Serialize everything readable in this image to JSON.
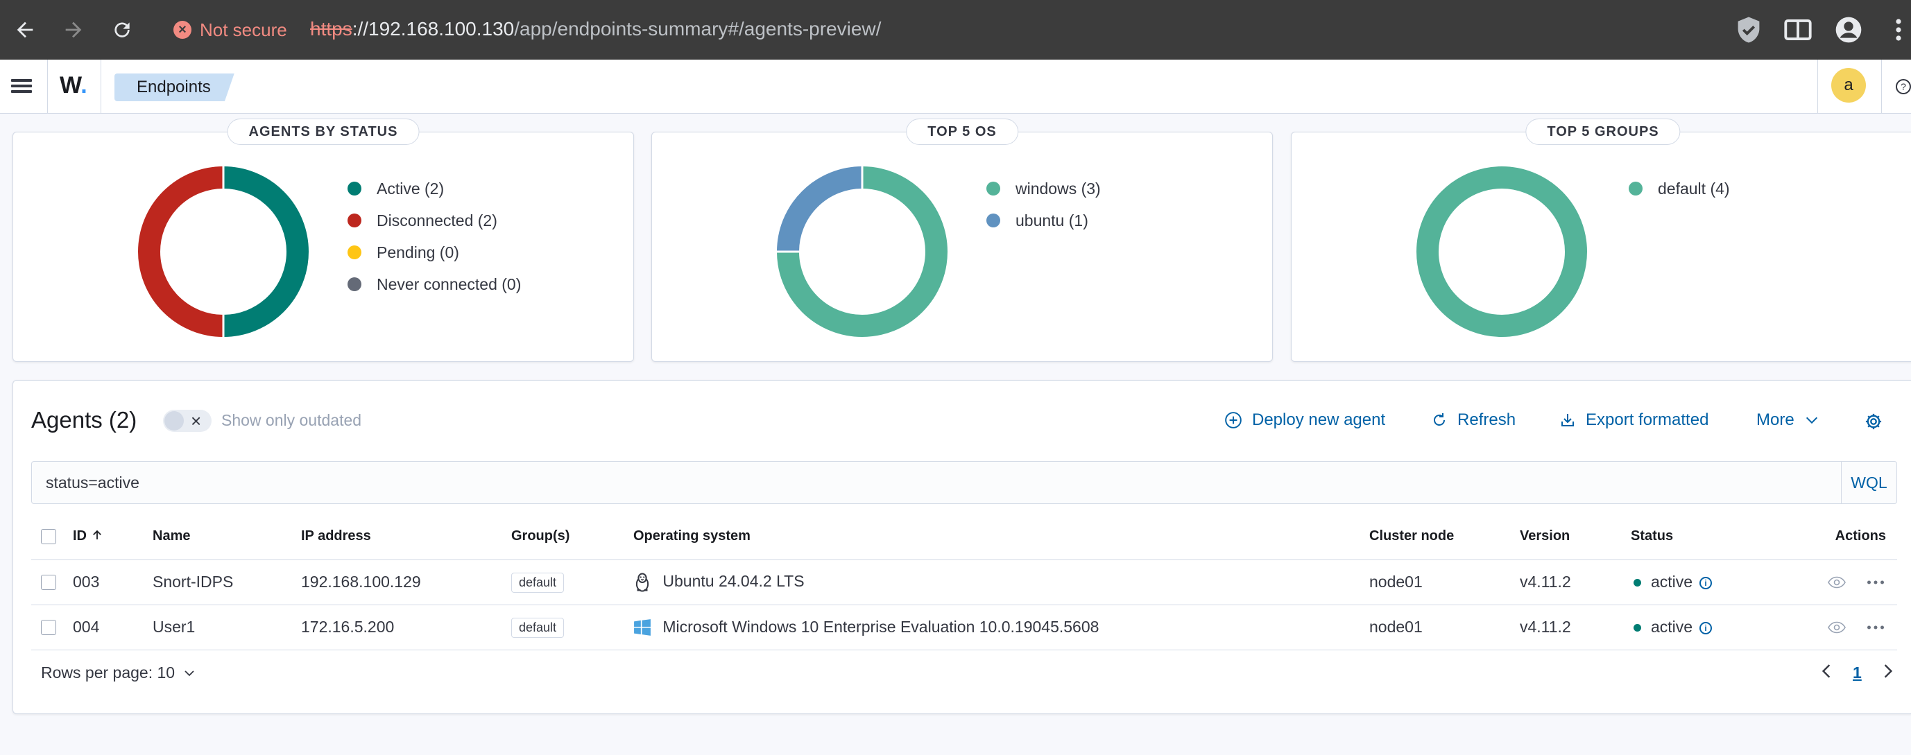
{
  "browser": {
    "security_label": "Not secure",
    "url_scheme": "https",
    "url_host": "://192.168.100.130",
    "url_path": "/app/endpoints-summary#/agents-preview/"
  },
  "header": {
    "logo_text": "W",
    "logo_dot": ".",
    "breadcrumb": "Endpoints",
    "avatar_initial": "a",
    "help_glyph": "?"
  },
  "cards": {
    "status": {
      "title": "AGENTS BY STATUS",
      "legend": [
        {
          "label": "Active (2)",
          "color": "#017d73",
          "value": 2
        },
        {
          "label": "Disconnected (2)",
          "color": "#bd271e",
          "value": 2
        },
        {
          "label": "Pending (0)",
          "color": "#fec514",
          "value": 0
        },
        {
          "label": "Never connected (0)",
          "color": "#646a77",
          "value": 0
        }
      ]
    },
    "os": {
      "title": "TOP 5 OS",
      "legend": [
        {
          "label": "windows (3)",
          "color": "#54b399",
          "value": 3
        },
        {
          "label": "ubuntu (1)",
          "color": "#6092c0",
          "value": 1
        }
      ]
    },
    "groups": {
      "title": "TOP 5 GROUPS",
      "legend": [
        {
          "label": "default (4)",
          "color": "#54b399",
          "value": 4
        }
      ]
    }
  },
  "agents": {
    "title": "Agents (2)",
    "outdated_label": "Show only outdated",
    "deploy_label": "Deploy new agent",
    "refresh_label": "Refresh",
    "export_label": "Export formatted",
    "more_label": "More",
    "search_value": "status=active",
    "wql_label": "WQL",
    "columns": {
      "id": "ID",
      "name": "Name",
      "ip": "IP address",
      "groups": "Group(s)",
      "os": "Operating system",
      "node": "Cluster node",
      "version": "Version",
      "status": "Status",
      "actions": "Actions"
    },
    "rows": [
      {
        "id": "003",
        "name": "Snort-IDPS",
        "ip": "192.168.100.129",
        "group": "default",
        "os": "Ubuntu 24.04.2 LTS",
        "os_icon": "linux-icon",
        "node": "node01",
        "version": "v4.11.2",
        "status": "active"
      },
      {
        "id": "004",
        "name": "User1",
        "ip": "172.16.5.200",
        "group": "default",
        "os": "Microsoft Windows 10 Enterprise Evaluation 10.0.19045.5608",
        "os_icon": "windows-icon",
        "node": "node01",
        "version": "v4.11.2",
        "status": "active"
      }
    ],
    "rows_per_page_label": "Rows per page: 10",
    "current_page": "1"
  }
}
